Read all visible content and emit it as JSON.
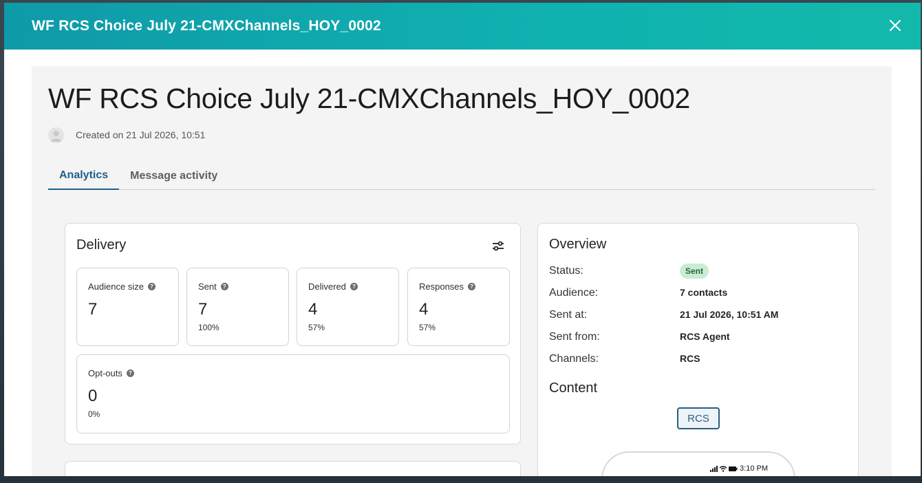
{
  "modal": {
    "header_title": "WF RCS Choice July 21-CMXChannels_HOY_0002",
    "close_icon": "close-icon"
  },
  "page": {
    "title": "WF RCS Choice July 21-CMXChannels_HOY_0002",
    "created": "Created on 21 Jul 2026, 10:51",
    "avatar_icon": "user-avatar-icon"
  },
  "tabs": [
    {
      "label": "Analytics",
      "active": true
    },
    {
      "label": "Message activity",
      "active": false
    }
  ],
  "delivery": {
    "title": "Delivery",
    "filter_icon": "sliders-icon",
    "stats": [
      {
        "label": "Audience size",
        "value": "7",
        "pct": ""
      },
      {
        "label": "Sent",
        "value": "7",
        "pct": "100%"
      },
      {
        "label": "Delivered",
        "value": "4",
        "pct": "57%"
      },
      {
        "label": "Responses",
        "value": "4",
        "pct": "57%"
      },
      {
        "label": "Opt-outs",
        "value": "0",
        "pct": "0%"
      }
    ]
  },
  "overview": {
    "title": "Overview",
    "rows": [
      {
        "label": "Status:",
        "value": "Sent"
      },
      {
        "label": "Audience:",
        "value": "7 contacts"
      },
      {
        "label": "Sent at:",
        "value": "21 Jul 2026, 10:51 AM"
      },
      {
        "label": "Sent from:",
        "value": "RCS Agent"
      },
      {
        "label": "Channels:",
        "value": "RCS"
      }
    ],
    "content_title": "Content",
    "content_button": "RCS",
    "phone_time": "3:10 PM"
  },
  "colors": {
    "header_teal": "#10b2b0",
    "active_tab": "#1d5f8a",
    "status_badge_bg": "#c9ecd2",
    "status_badge_text": "#25663c"
  }
}
